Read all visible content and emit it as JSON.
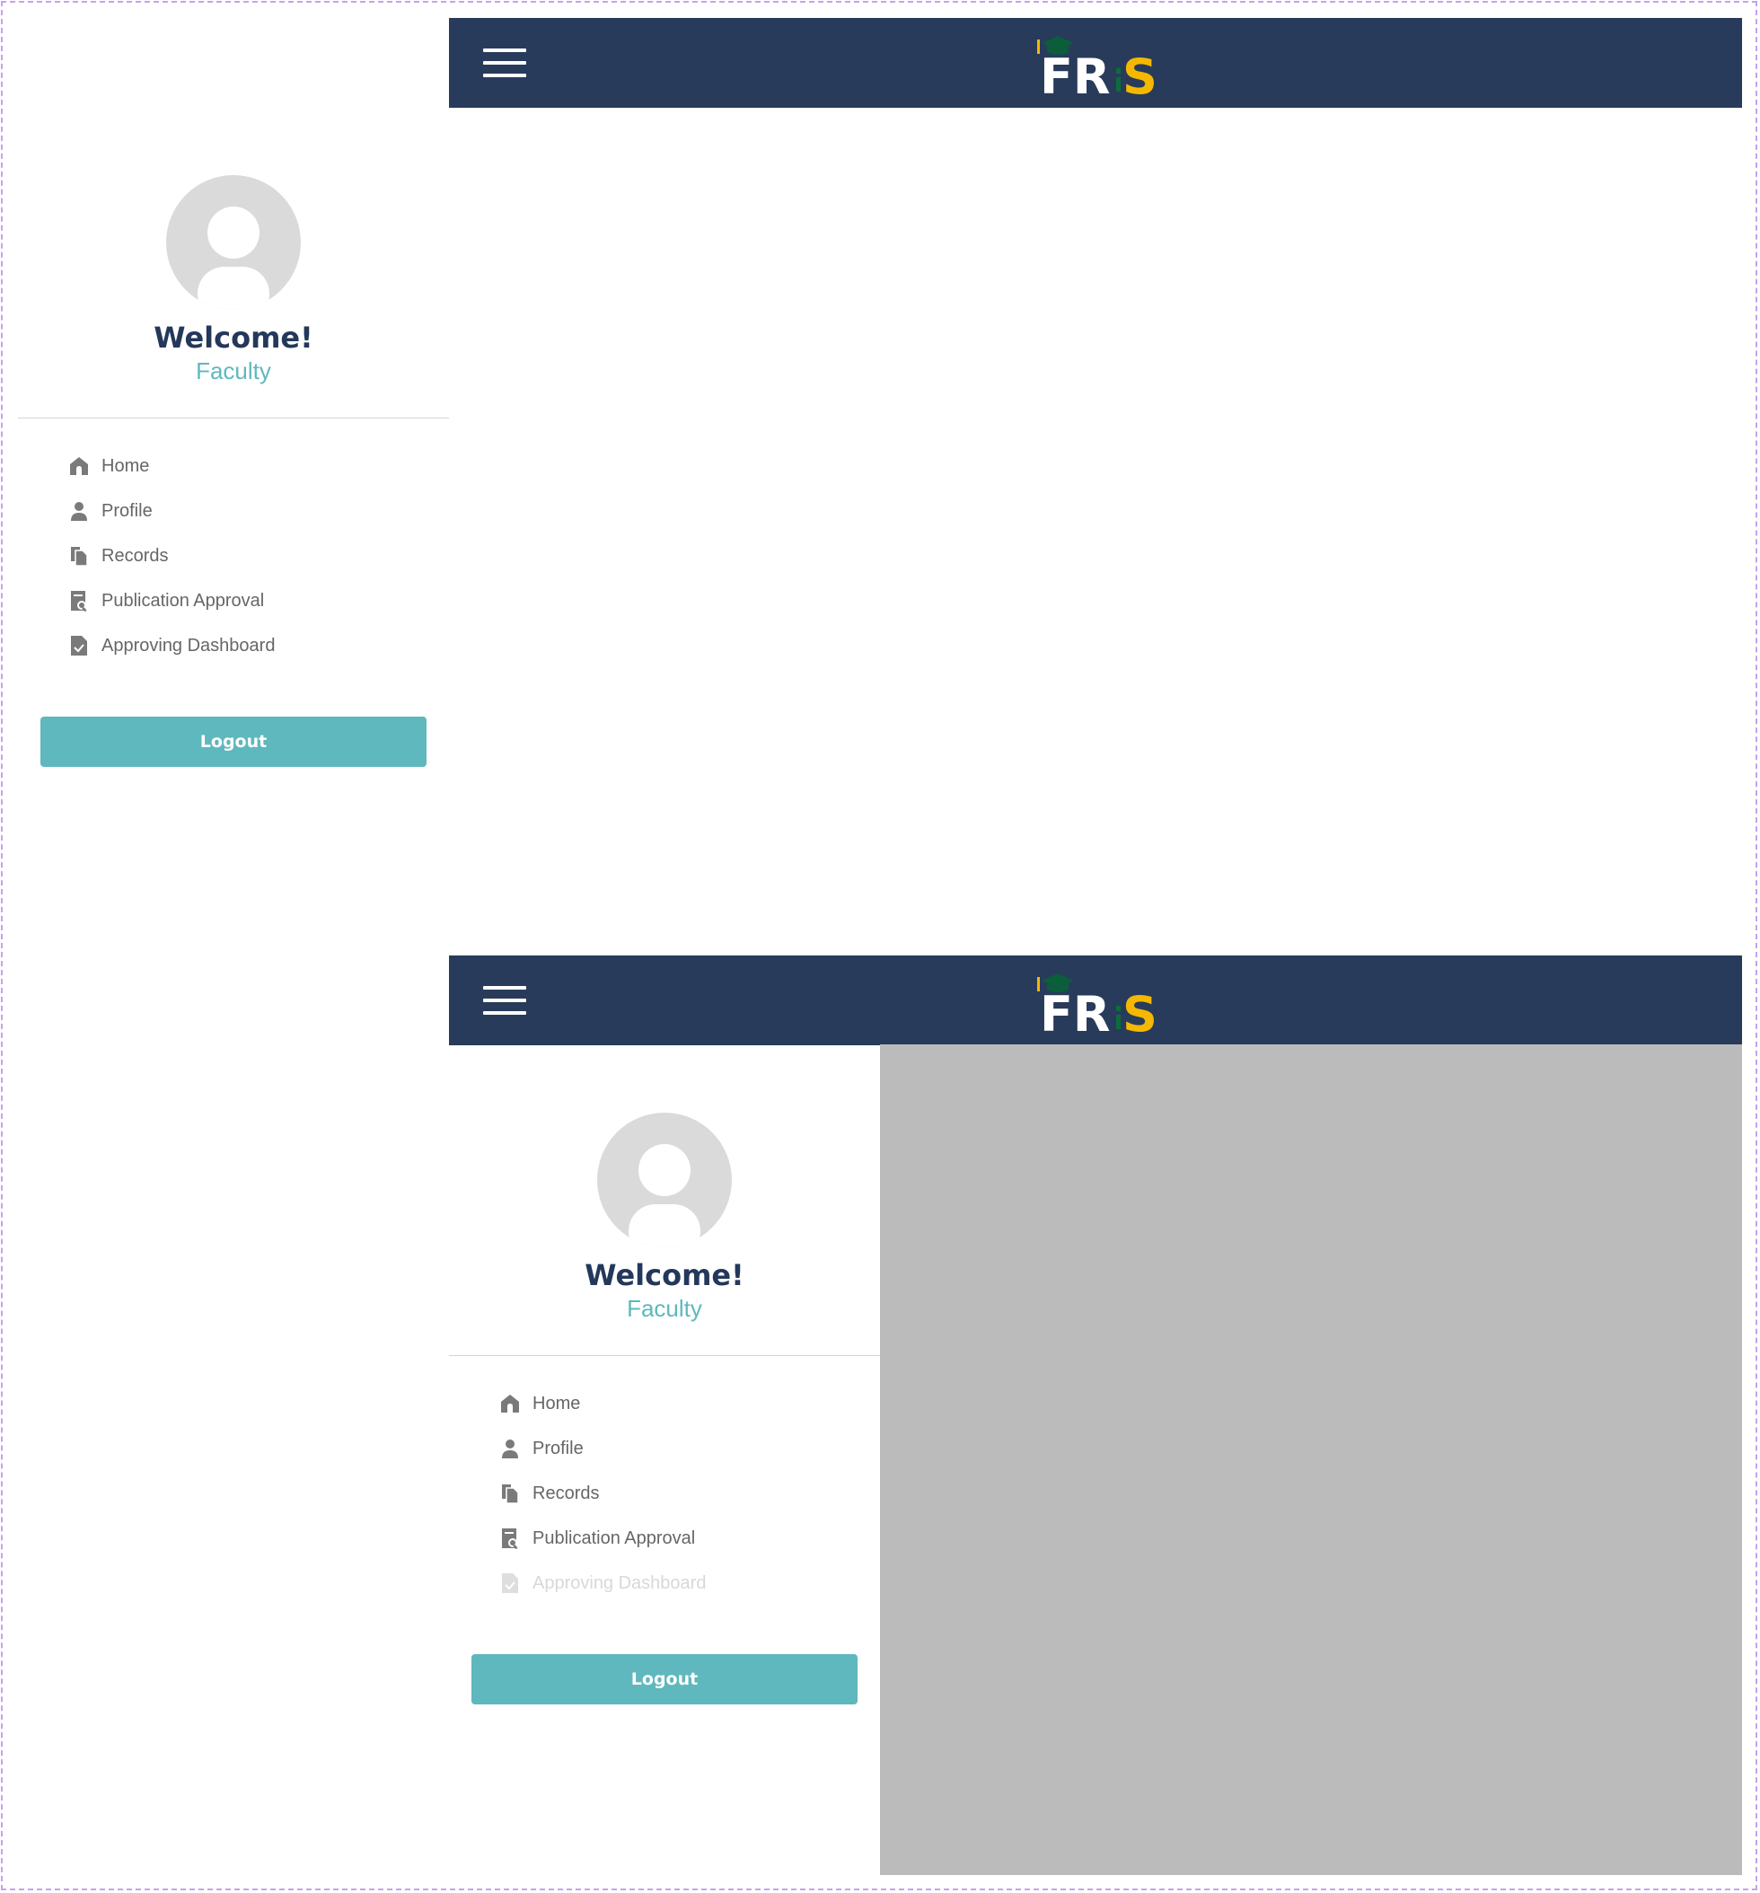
{
  "brand": {
    "logo_text": "FRIS",
    "logo_colors": {
      "fr": "#ffffff",
      "i": "#0b6e3c",
      "s": "#f5b800",
      "cap": "#0b5e3a",
      "tassel": "#f5b800"
    }
  },
  "colors": {
    "header_bg": "#283b5b",
    "accent": "#5fb8bd",
    "title": "#23385a",
    "overlay": "#bbbbbb"
  },
  "sidebar": {
    "welcome": "Welcome!",
    "role": "Faculty",
    "menu": [
      {
        "label": "Home",
        "icon": "home-icon"
      },
      {
        "label": "Profile",
        "icon": "user-icon"
      },
      {
        "label": "Records",
        "icon": "files-icon"
      },
      {
        "label": "Publication Approval",
        "icon": "document-search-icon"
      },
      {
        "label": "Approving Dashboard",
        "icon": "document-check-icon"
      }
    ],
    "logout": "Logout"
  },
  "state": {
    "view1": "sidebar closed",
    "view2": "sidebar open with overlay",
    "view2_faded_item": "Approving Dashboard"
  }
}
